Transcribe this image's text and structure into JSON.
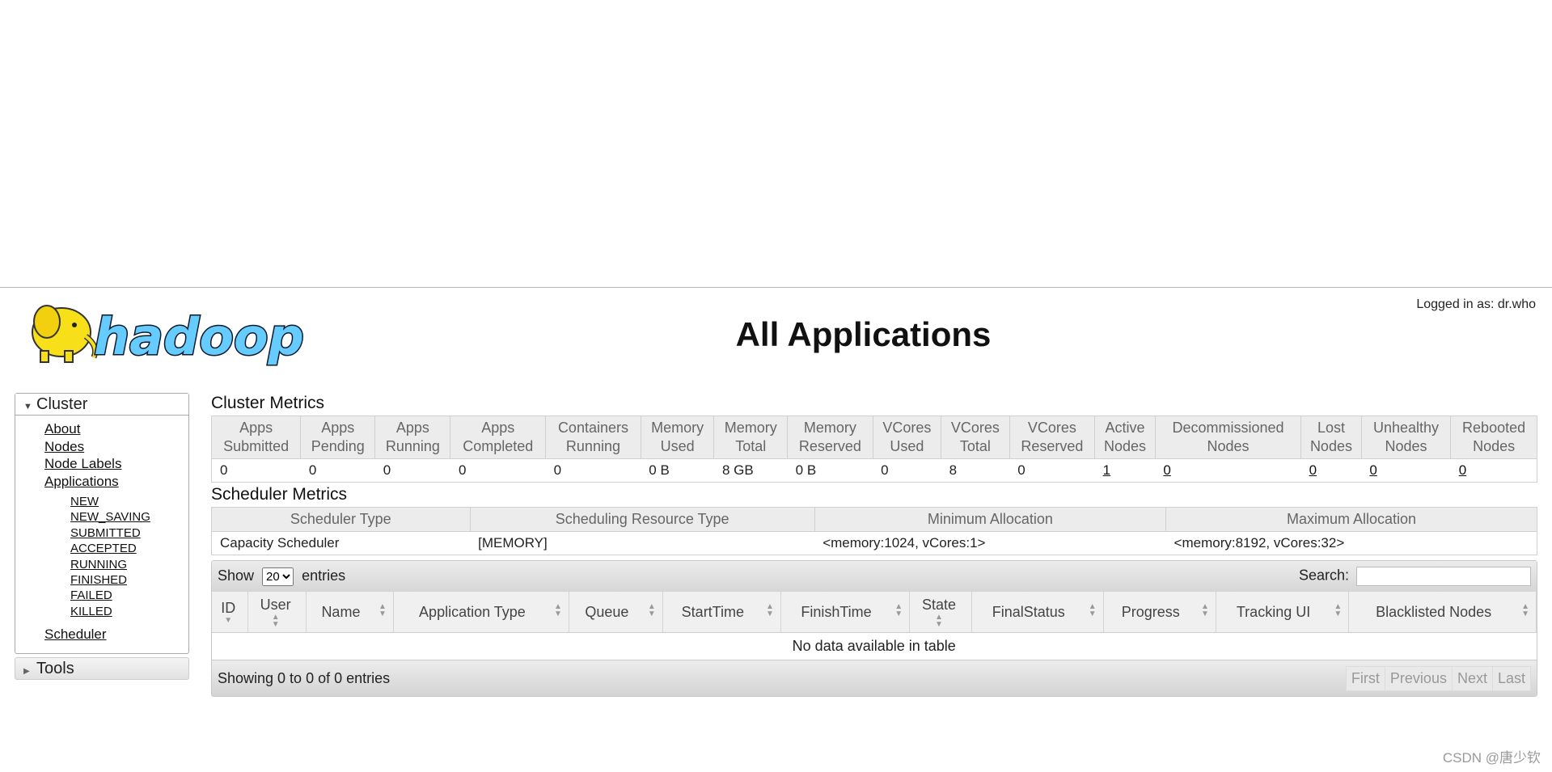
{
  "header": {
    "logged_in": "Logged in as: dr.who",
    "title": "All Applications",
    "logo_text": "hadoop"
  },
  "sidebar": {
    "cluster_label": "Cluster",
    "cluster_links": [
      "About",
      "Nodes",
      "Node Labels",
      "Applications"
    ],
    "app_states": [
      "NEW",
      "NEW_SAVING",
      "SUBMITTED",
      "ACCEPTED",
      "RUNNING",
      "FINISHED",
      "FAILED",
      "KILLED"
    ],
    "scheduler_link": "Scheduler",
    "tools_label": "Tools"
  },
  "cluster_metrics": {
    "title": "Cluster Metrics",
    "headers": [
      [
        "Apps",
        "Submitted"
      ],
      [
        "Apps",
        "Pending"
      ],
      [
        "Apps",
        "Running"
      ],
      [
        "Apps",
        "Completed"
      ],
      [
        "Containers",
        "Running"
      ],
      [
        "Memory",
        "Used"
      ],
      [
        "Memory",
        "Total"
      ],
      [
        "Memory",
        "Reserved"
      ],
      [
        "VCores",
        "Used"
      ],
      [
        "VCores",
        "Total"
      ],
      [
        "VCores",
        "Reserved"
      ],
      [
        "Active",
        "Nodes"
      ],
      [
        "Decommissioned",
        "Nodes"
      ],
      [
        "Lost",
        "Nodes"
      ],
      [
        "Unhealthy",
        "Nodes"
      ],
      [
        "Rebooted",
        "Nodes"
      ]
    ],
    "values": [
      "0",
      "0",
      "0",
      "0",
      "0",
      "0 B",
      "8 GB",
      "0 B",
      "0",
      "8",
      "0",
      "1",
      "0",
      "0",
      "0",
      "0"
    ],
    "link_cols": [
      11,
      12,
      13,
      14,
      15
    ]
  },
  "scheduler_metrics": {
    "title": "Scheduler Metrics",
    "headers": [
      "Scheduler Type",
      "Scheduling Resource Type",
      "Minimum Allocation",
      "Maximum Allocation"
    ],
    "values": [
      "Capacity Scheduler",
      "[MEMORY]",
      "<memory:1024, vCores:1>",
      "<memory:8192, vCores:32>"
    ]
  },
  "apps_table": {
    "show_label": "Show",
    "entries_label": "entries",
    "page_size": "20",
    "search_label": "Search:",
    "columns": [
      "ID",
      "User",
      "Name",
      "Application Type",
      "Queue",
      "StartTime",
      "FinishTime",
      "State",
      "FinalStatus",
      "Progress",
      "Tracking UI",
      "Blacklisted Nodes"
    ],
    "empty_message": "No data available in table",
    "info": "Showing 0 to 0 of 0 entries",
    "pager": [
      "First",
      "Previous",
      "Next",
      "Last"
    ]
  },
  "watermark": "CSDN @唐少钦",
  "colors": {
    "logo_yellow": "#f7e01a",
    "logo_blue": "#66ccff",
    "header_gray": "#ececec"
  }
}
